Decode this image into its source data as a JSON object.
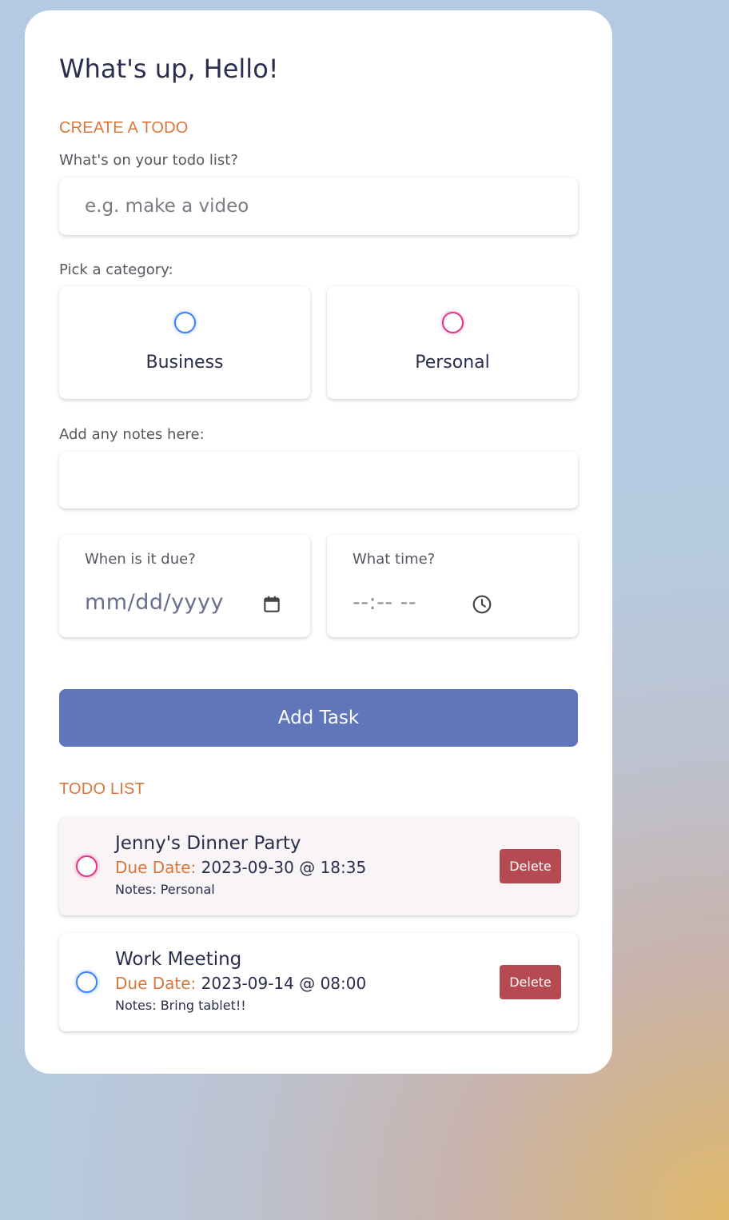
{
  "greeting": "What's up, Hello!",
  "create_section": {
    "title": "CREATE A TODO",
    "todo_label": "What's on your todo list?",
    "todo_placeholder": "e.g. make a video",
    "category_label": "Pick a category:",
    "categories": [
      {
        "label": "Business",
        "color": "#3a82f7"
      },
      {
        "label": "Personal",
        "color": "#e0368a"
      }
    ],
    "notes_label": "Add any notes here:",
    "notes_value": "",
    "due_date_label": "When is it due?",
    "due_date_placeholder": "mm/dd/yyyy",
    "time_label": "What time?",
    "time_placeholder": "--:-- --",
    "add_button_label": "Add Task"
  },
  "todo_section": {
    "title": "TODO LIST",
    "items": [
      {
        "title": "Jenny's Dinner Party",
        "due_label": "Due Date:",
        "due_value": "2023-09-30 @ 18:35",
        "notes": "Notes: Personal",
        "category": "Personal",
        "category_color": "#e0368a",
        "background": "#f9f4f5",
        "delete_label": "Delete"
      },
      {
        "title": "Work Meeting",
        "due_label": "Due Date:",
        "due_value": "2023-09-14 @ 08:00",
        "notes": "Notes: Bring tablet!!",
        "category": "Business",
        "category_color": "#3a82f7",
        "background": "#ffffff",
        "delete_label": "Delete"
      }
    ]
  },
  "colors": {
    "accent": "#6076bb",
    "section_title": "#d9773a",
    "delete": "#b64a52",
    "text": "#2b2d4e"
  },
  "icons": {
    "date": "calendar-icon",
    "time": "clock-icon"
  }
}
